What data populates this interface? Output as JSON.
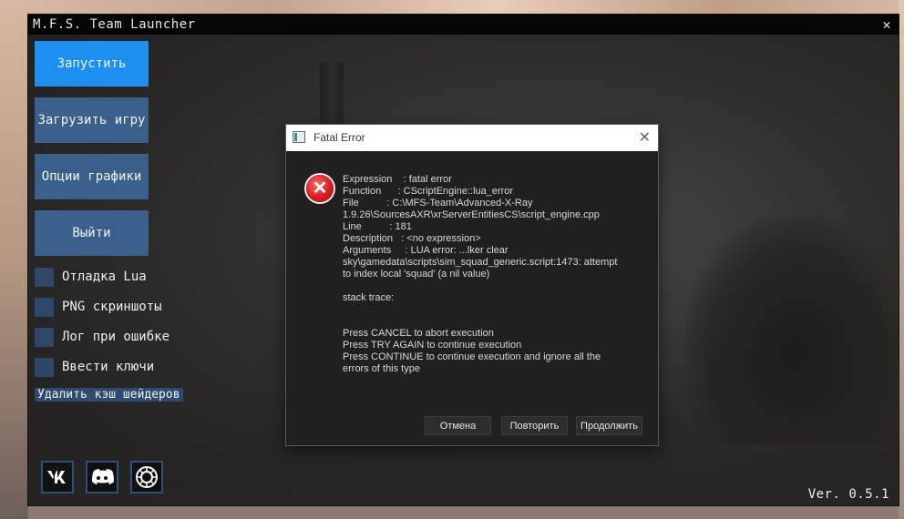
{
  "launcher": {
    "title": "M.F.S. Team Launcher",
    "close": "✕",
    "buttons": {
      "launch": "Запустить",
      "load": "Загрузить игру",
      "graphics": "Опции графики",
      "exit": "Выйти"
    },
    "checkboxes": {
      "lua_debug": "Отладка Lua",
      "png_screens": "PNG скриншоты",
      "error_log": "Лог при ошибке",
      "enter_keys": "Ввести ключи"
    },
    "clear_cache": "Удалить кэш шейдеров",
    "social": [
      "vk-icon",
      "discord-icon",
      "website-icon"
    ],
    "version": "Ver. 0.5.1"
  },
  "dialog": {
    "title": "Fatal Error",
    "close": "✕",
    "icon": "error-icon",
    "lines": [
      "Expression    : fatal error",
      "Function      : CScriptEngine::lua_error",
      "File          : C:\\MFS-Team\\Advanced-X-Ray",
      "1.9.26\\SourcesAXR\\xrServerEntitiesCS\\script_engine.cpp",
      "Line          : 181",
      "Description   : <no expression>",
      "Arguments     : LUA error: ...lker clear",
      "sky\\gamedata\\scripts\\sim_squad_generic.script:1473: attempt",
      "to index local 'squad' (a nil value)",
      "",
      "stack trace:",
      "",
      "",
      "Press CANCEL to abort execution",
      "Press TRY AGAIN to continue execution",
      "Press CONTINUE to continue execution and ignore all the",
      "errors of this type"
    ],
    "buttons": {
      "cancel": "Отмена",
      "retry": "Повторить",
      "continue": "Продолжить"
    }
  },
  "colors": {
    "primary_button": "#1e8ef0",
    "button": "#3a5f8a",
    "checkbox": "#2e4768",
    "titlebar": "#050505",
    "dialog_bg": "#202020"
  }
}
